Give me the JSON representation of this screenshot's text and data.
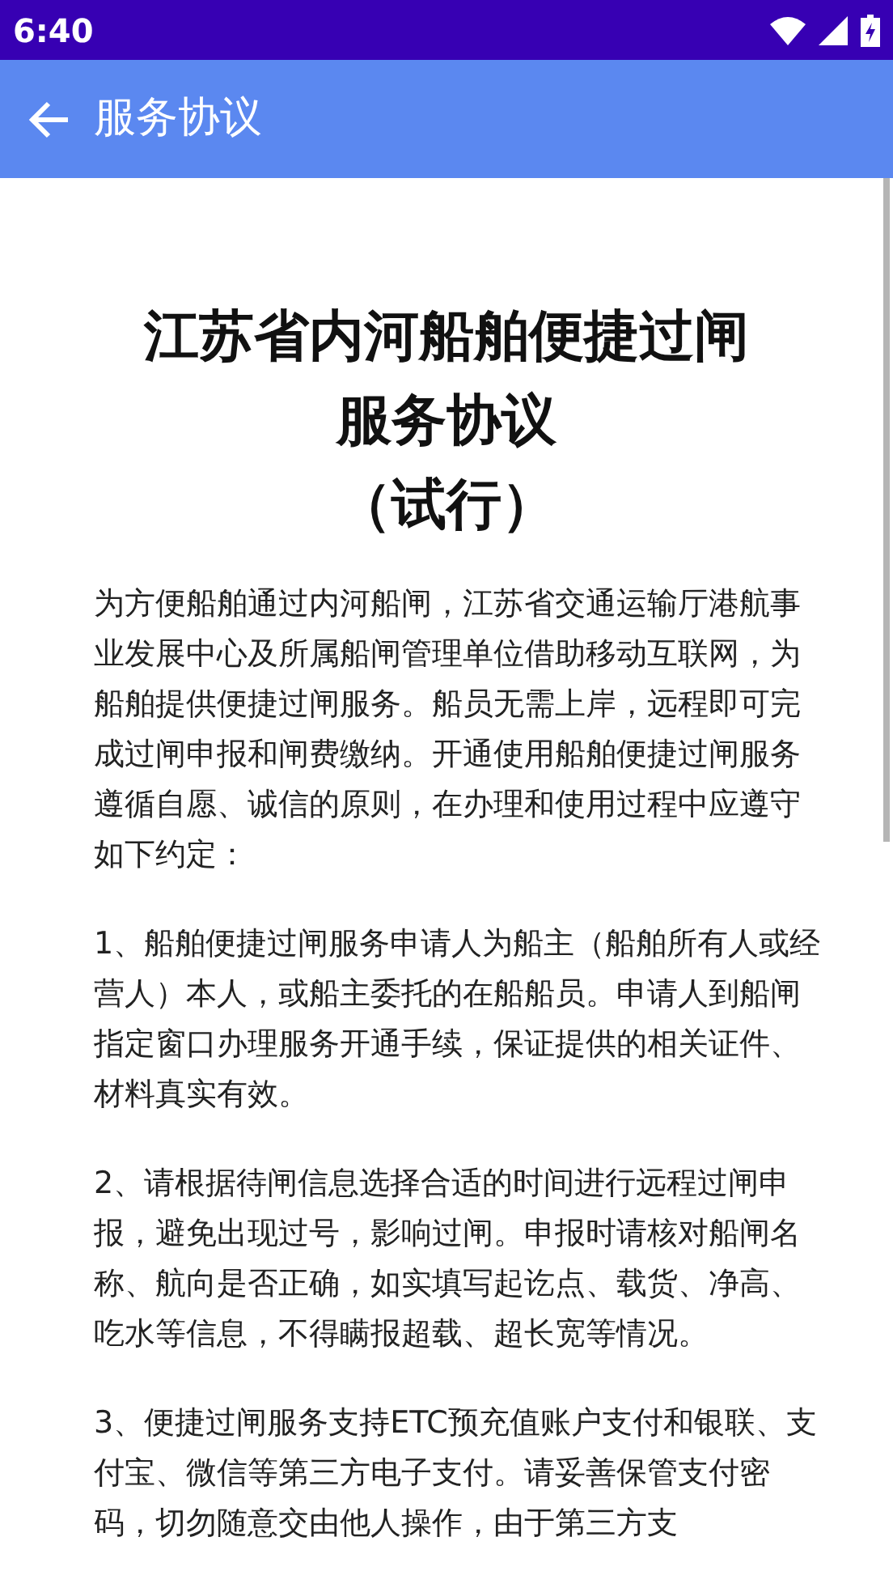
{
  "status_bar": {
    "time": "6:40"
  },
  "app_bar": {
    "title": "服务协议"
  },
  "document": {
    "title_lines": [
      "江苏省内河船舶便捷过闸",
      "服务协议",
      "（试行）"
    ],
    "paragraphs": [
      "为方便船舶通过内河船闸，江苏省交通运输厅港航事业发展中心及所属船闸管理单位借助移动互联网，为船舶提供便捷过闸服务。船员无需上岸，远程即可完成过闸申报和闸费缴纳。开通使用船舶便捷过闸服务遵循自愿、诚信的原则，在办理和使用过程中应遵守如下约定：",
      "1、船舶便捷过闸服务申请人为船主（船舶所有人或经营人）本人，或船主委托的在船船员。申请人到船闸指定窗口办理服务开通手续，保证提供的相关证件、材料真实有效。",
      "2、请根据待闸信息选择合适的时间进行远程过闸申报，避免出现过号，影响过闸。申报时请核对船闸名称、航向是否正确，如实填写起讫点、载货、净高、吃水等信息，不得瞒报超载、超长宽等情况。",
      "3、便捷过闸服务支持ETC预充值账户支付和银联、支付宝、微信等第三方电子支付。请妥善保管支付密码，切勿随意交由他人操作，由于第三方支"
    ]
  }
}
